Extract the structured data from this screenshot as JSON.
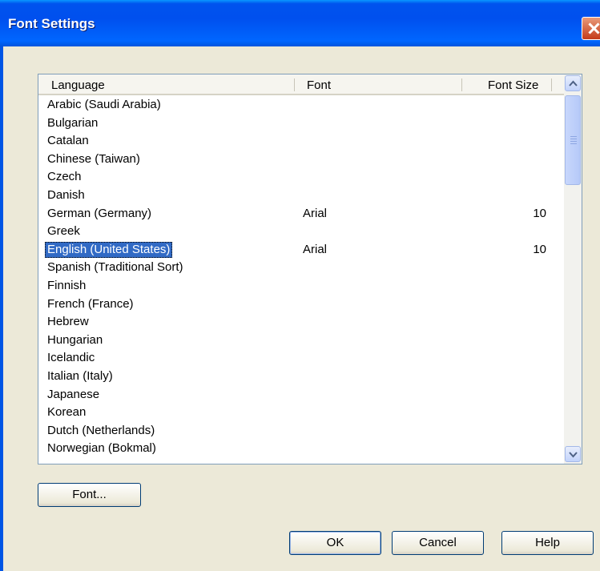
{
  "window": {
    "title": "Font Settings"
  },
  "list": {
    "columns": {
      "language": "Language",
      "font": "Font",
      "font_size": "Font Size"
    },
    "rows": [
      {
        "language": "Arabic (Saudi Arabia)",
        "font": "",
        "size": ""
      },
      {
        "language": "Bulgarian",
        "font": "",
        "size": ""
      },
      {
        "language": "Catalan",
        "font": "",
        "size": ""
      },
      {
        "language": "Chinese (Taiwan)",
        "font": "",
        "size": ""
      },
      {
        "language": "Czech",
        "font": "",
        "size": ""
      },
      {
        "language": "Danish",
        "font": "",
        "size": ""
      },
      {
        "language": "German (Germany)",
        "font": "Arial",
        "size": "10"
      },
      {
        "language": "Greek",
        "font": "",
        "size": ""
      },
      {
        "language": "English (United States)",
        "font": "Arial",
        "size": "10",
        "selected": true
      },
      {
        "language": "Spanish (Traditional Sort)",
        "font": "",
        "size": ""
      },
      {
        "language": "Finnish",
        "font": "",
        "size": ""
      },
      {
        "language": "French (France)",
        "font": "",
        "size": ""
      },
      {
        "language": "Hebrew",
        "font": "",
        "size": ""
      },
      {
        "language": "Hungarian",
        "font": "",
        "size": ""
      },
      {
        "language": "Icelandic",
        "font": "",
        "size": ""
      },
      {
        "language": "Italian (Italy)",
        "font": "",
        "size": ""
      },
      {
        "language": "Japanese",
        "font": "",
        "size": ""
      },
      {
        "language": "Korean",
        "font": "",
        "size": ""
      },
      {
        "language": "Dutch (Netherlands)",
        "font": "",
        "size": ""
      },
      {
        "language": "Norwegian (Bokmal)",
        "font": "",
        "size": ""
      }
    ]
  },
  "buttons": {
    "font": "Font...",
    "ok": "OK",
    "cancel": "Cancel",
    "help": "Help"
  },
  "icons": {
    "close": "close-icon",
    "scroll_up": "chevron-up-icon",
    "scroll_down": "chevron-down-icon"
  },
  "colors": {
    "titlebar": "#0054e3",
    "selection": "#316ac5",
    "close": "#c43b1a"
  }
}
